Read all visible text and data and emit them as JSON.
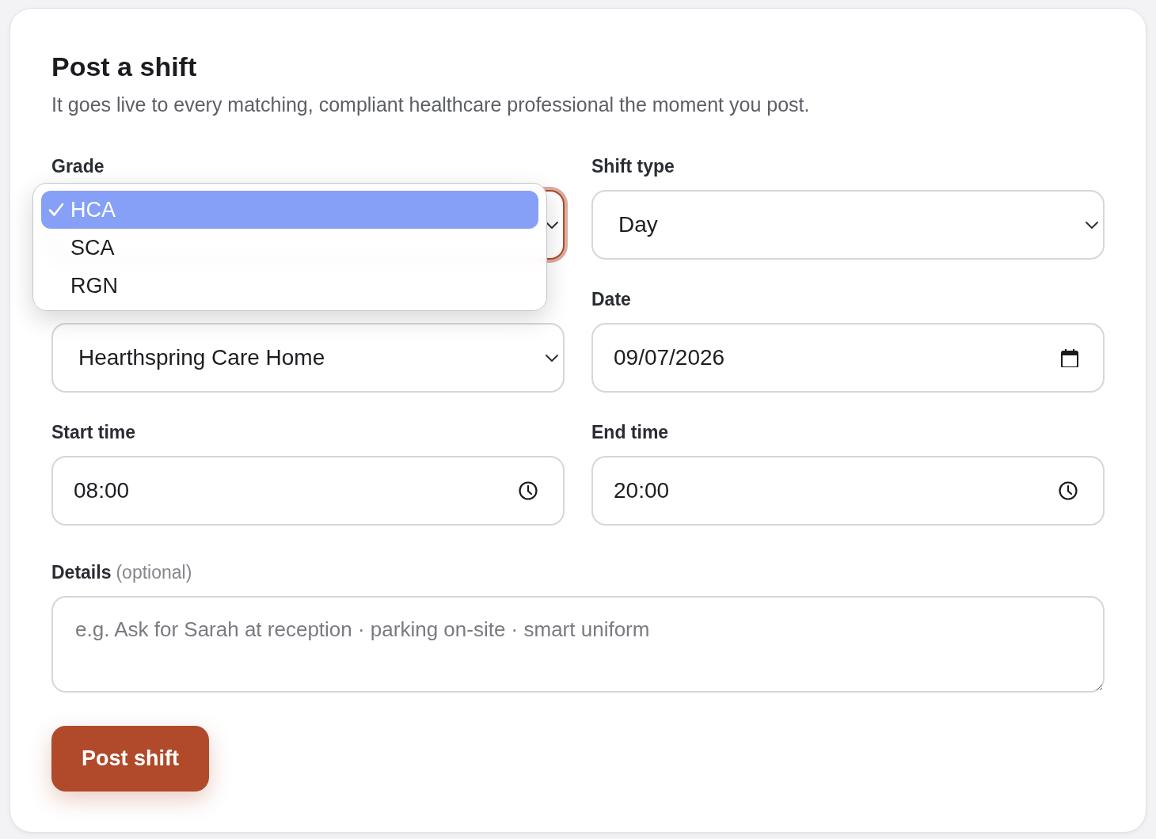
{
  "form": {
    "title": "Post a shift",
    "subtitle": "It goes live to every matching, compliant healthcare professional the moment you post."
  },
  "fields": [
    {
      "kind": "select",
      "label": "Grade",
      "focused": true
    },
    {
      "kind": "select",
      "label": "Shift type",
      "value": "Day",
      "focused": false
    },
    {
      "kind": "select",
      "value": "Hearthspring Care Home",
      "focused": false
    },
    {
      "kind": "date",
      "label": "Date",
      "value": "09/07/2026",
      "focused": false
    },
    {
      "kind": "time",
      "label": "Start time",
      "value": "08:00",
      "focused": false
    },
    {
      "kind": "time",
      "label": "End time",
      "value": "20:00",
      "focused": false
    }
  ],
  "details": {
    "label": "Details",
    "hint": "(optional)",
    "placeholder": "e.g. Ask for Sarah at reception · parking on-site · smart uniform"
  },
  "submit_button": "Post shift",
  "grade_menu": {
    "options": [
      {
        "label": "HCA",
        "selected": true
      },
      {
        "label": "SCA",
        "selected": false
      },
      {
        "label": "RGN",
        "selected": false
      }
    ]
  }
}
